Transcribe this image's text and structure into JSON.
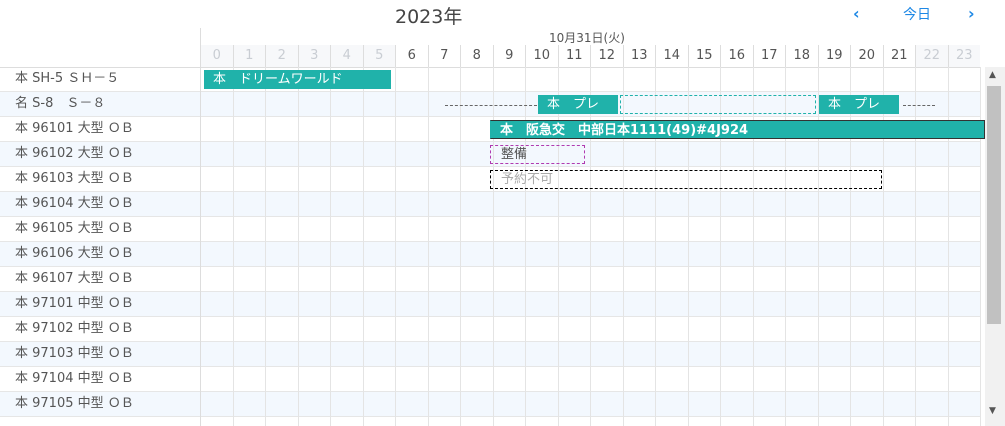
{
  "header": {
    "year": "2023年",
    "prev_icon": "‹",
    "next_icon": "›",
    "today_label": "今日",
    "date_label": "10月31日(火)"
  },
  "hours": [
    {
      "label": "0",
      "off": true
    },
    {
      "label": "1",
      "off": true
    },
    {
      "label": "2",
      "off": true
    },
    {
      "label": "3",
      "off": true
    },
    {
      "label": "4",
      "off": true
    },
    {
      "label": "5",
      "off": true
    },
    {
      "label": "6",
      "off": false
    },
    {
      "label": "7",
      "off": false
    },
    {
      "label": "8",
      "off": false
    },
    {
      "label": "9",
      "off": false
    },
    {
      "label": "10",
      "off": false
    },
    {
      "label": "11",
      "off": false
    },
    {
      "label": "12",
      "off": false
    },
    {
      "label": "13",
      "off": false
    },
    {
      "label": "14",
      "off": false
    },
    {
      "label": "15",
      "off": false
    },
    {
      "label": "16",
      "off": false
    },
    {
      "label": "17",
      "off": false
    },
    {
      "label": "18",
      "off": false
    },
    {
      "label": "19",
      "off": false
    },
    {
      "label": "20",
      "off": false
    },
    {
      "label": "21",
      "off": false
    },
    {
      "label": "22",
      "off": true
    },
    {
      "label": "23",
      "off": true
    }
  ],
  "rows": [
    "本 SH-5 ＳＨ－５",
    "名 S-8　Ｓ－８",
    "本 96101 大型 ＯＢ",
    "本 96102 大型 ＯＢ",
    "本 96103 大型 ＯＢ",
    "本 96104 大型 ＯＢ",
    "本 96105 大型 ＯＢ",
    "本 96106 大型 ＯＢ",
    "本 96107 大型 ＯＢ",
    "本 97101 中型 ＯＢ",
    "本 97102 中型 ＯＢ",
    "本 97103 中型 ＯＢ",
    "本 97104 中型 ＯＢ",
    "本 97105 中型 ＯＢ"
  ],
  "events": {
    "dream_world": "本　ドリームワールド",
    "pre_1": "本　プレ",
    "pre_2": "本　プレ",
    "hankyu": "本　阪急交　中部日本1111(49)#4J924",
    "maintenance": "整備",
    "unavailable": "予約不可"
  },
  "scrollbar": {
    "up": "▲",
    "down": "▼"
  }
}
